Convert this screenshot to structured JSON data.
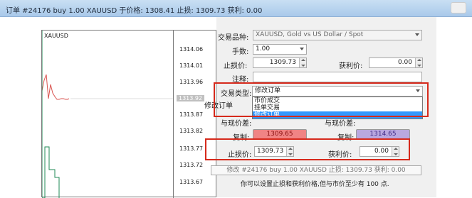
{
  "window": {
    "title": "订单 #24176 buy 1.00 XAUUSD 于价格: 1308.41 止损: 1309.73 获利: 0.00"
  },
  "chart": {
    "symbol": "XAUUSD",
    "price_ticks": [
      "1314.06",
      "1314.01",
      "1313.96",
      "1313.92",
      "1313.87",
      "1313.82",
      "1313.77",
      "1313.72",
      "1313.67"
    ],
    "current_price_tick": "1313.92"
  },
  "form": {
    "symbol_label": "交易品种:",
    "symbol_value": "XAUUSD, Gold vs US Dollar / Spot",
    "volume_label": "手数:",
    "volume_value": "1.00",
    "sl_label": "止损价:",
    "sl_value": "1309.73",
    "tp_label": "获利价:",
    "tp_value": "0.00",
    "comment_label": "注释:",
    "comment_value": "",
    "type_label": "交易类型:",
    "type_value": "修改订单",
    "type_options": [
      "市价成交",
      "挂单交易",
      "修改订单"
    ],
    "modify_order_label": "修改订单",
    "deviation_label_left": "与现价差:",
    "deviation_label_right": "与现价差:",
    "copy_left_label": "复制:",
    "copy_left_value": "1309.65",
    "copy_right_label": "复制:",
    "copy_right_value": "1314.65",
    "modify_sl_label": "止损价:",
    "modify_sl_value": "1309.73",
    "modify_tp_label": "获利价:",
    "modify_tp_value": "0.00",
    "info_line": "修改 #24176 buy 1.00 XAUUSD 止损: 1309.73 获利: 0.00",
    "note": "你可以设置止损和获利价格,但与市价至少有 100 点."
  },
  "colors": {
    "highlight_border": "#d62a1c",
    "selection_blue": "#3399ff",
    "sell_red": "#f08484",
    "buy_purple": "#b9a8e0",
    "chart_line_red": "#d9534f",
    "chart_line_green": "#1f8a55"
  }
}
